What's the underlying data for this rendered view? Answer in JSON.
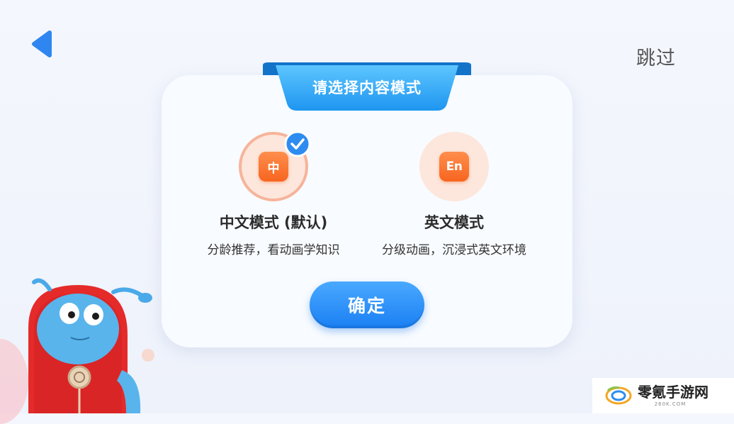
{
  "header": {
    "skip_label": "跳过"
  },
  "dialog": {
    "title": "请选择内容模式",
    "options": [
      {
        "badge": "中",
        "title": "中文模式 (默认)",
        "desc": "分龄推荐，看动画学知识",
        "selected": true
      },
      {
        "badge": "En",
        "title": "英文模式",
        "desc": "分级动画，沉浸式英文环境",
        "selected": false
      }
    ],
    "confirm_label": "确定"
  },
  "watermark": {
    "name": "零氪手游网",
    "domain": "260K.COM"
  },
  "colors": {
    "accent_blue": "#1a7ff3",
    "badge_orange": "#f7651f",
    "back_arrow": "#2f86f0"
  },
  "icons": {
    "back": "back-arrow-icon",
    "check": "check-icon"
  }
}
